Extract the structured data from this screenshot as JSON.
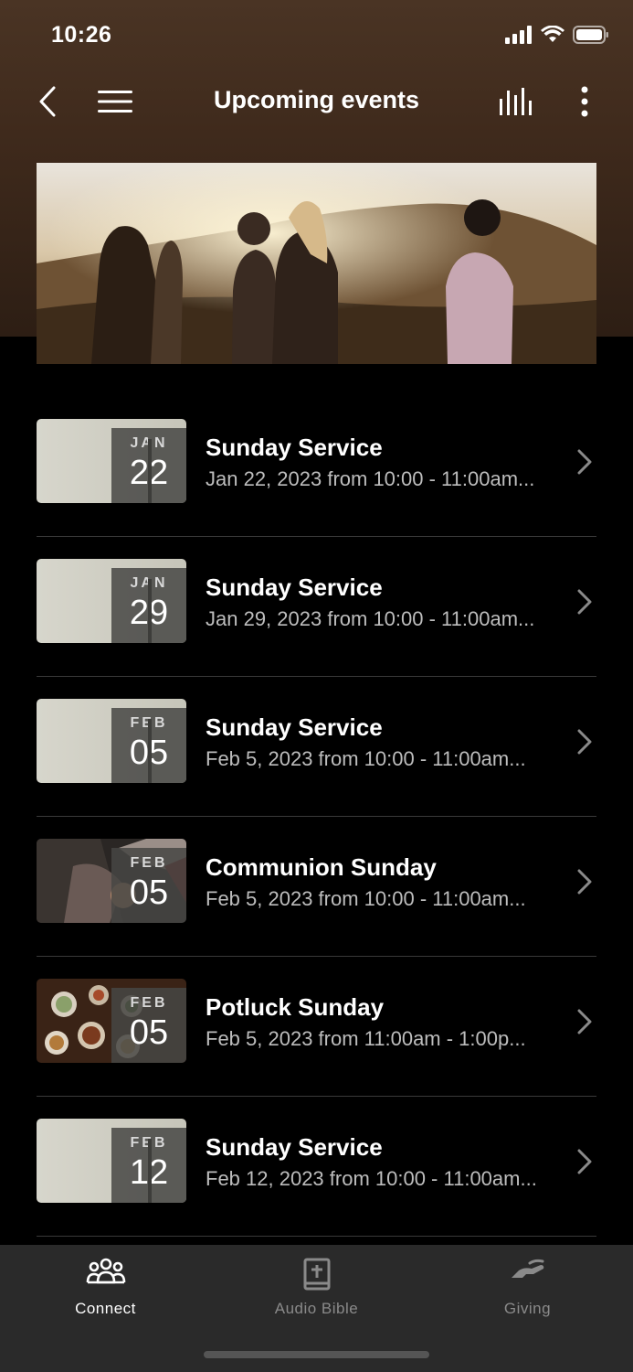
{
  "status_bar": {
    "time": "10:26"
  },
  "header": {
    "title": "Upcoming events"
  },
  "events": [
    {
      "month": "JAN",
      "day": "22",
      "title": "Sunday Service",
      "subtitle": "Jan 22, 2023 from 10:00 - 11:00am...",
      "thumb": "plain"
    },
    {
      "month": "JAN",
      "day": "29",
      "title": "Sunday Service",
      "subtitle": "Jan 29, 2023 from 10:00 - 11:00am...",
      "thumb": "plain"
    },
    {
      "month": "FEB",
      "day": "05",
      "title": "Sunday Service",
      "subtitle": "Feb 5, 2023 from 10:00 - 11:00am...",
      "thumb": "plain"
    },
    {
      "month": "FEB",
      "day": "05",
      "title": "Communion Sunday",
      "subtitle": "Feb 5, 2023 from 10:00 - 11:00am...",
      "thumb": "communion"
    },
    {
      "month": "FEB",
      "day": "05",
      "title": "Potluck Sunday",
      "subtitle": "Feb 5, 2023 from 11:00am - 1:00p...",
      "thumb": "potluck"
    },
    {
      "month": "FEB",
      "day": "12",
      "title": "Sunday Service",
      "subtitle": "Feb 12, 2023 from 10:00 - 11:00am...",
      "thumb": "plain"
    }
  ],
  "tabs": [
    {
      "label": "Connect",
      "icon": "people-icon",
      "active": true
    },
    {
      "label": "Audio Bible",
      "icon": "bible-icon",
      "active": false
    },
    {
      "label": "Giving",
      "icon": "giving-hand-icon",
      "active": false
    }
  ],
  "colors": {
    "header_bg": "#3f2a1c",
    "tab_bar_bg": "#2a2a2a",
    "active_tab": "#ffffff",
    "inactive_tab": "#8a8a8a"
  }
}
